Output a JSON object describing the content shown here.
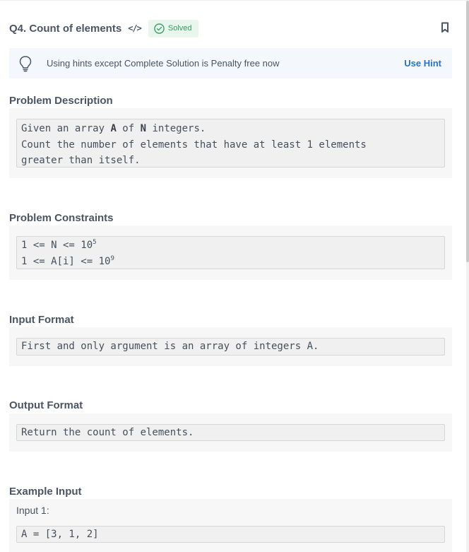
{
  "header": {
    "title": "Q4. Count of elements",
    "code_icon": "</>",
    "status": "Solved",
    "bookmark_icon": "bookmark-icon"
  },
  "hint": {
    "text": "Using hints except Complete Solution is Penalty free now",
    "button": "Use Hint",
    "icon": "lightbulb-icon"
  },
  "description": {
    "heading": "Problem Description",
    "line1_pre": "Given an array ",
    "line1_var1": "A",
    "line1_mid": " of ",
    "line1_var2": "N",
    "line1_post": " integers.",
    "line2": "Count the number of elements that have at least 1 elements",
    "line3": "greater than itself."
  },
  "constraints": {
    "heading": "Problem Constraints",
    "line1": "1 <= N <= 10",
    "line1_exp": "5",
    "line2": "1 <= A[i] <= 10",
    "line2_exp": "9"
  },
  "input_format": {
    "heading": "Input Format",
    "text": "First and only argument is an array of integers A."
  },
  "output_format": {
    "heading": "Output Format",
    "text": "Return the count of elements."
  },
  "example_input": {
    "heading": "Example Input",
    "label": "Input 1:",
    "value": "A = [3, 1, 2]"
  },
  "colors": {
    "accent": "#2874c9",
    "solved": "#2f9e5d"
  }
}
